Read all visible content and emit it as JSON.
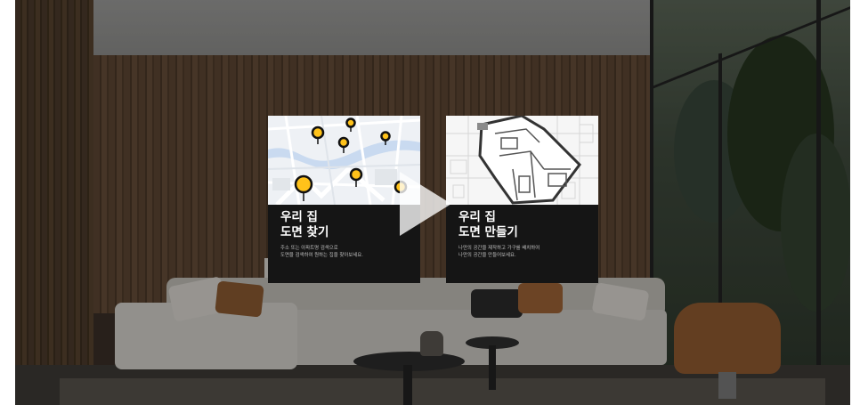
{
  "video": {
    "play_label": "play",
    "play_icon": "play-icon"
  },
  "cards": [
    {
      "title_line1": "우리 집",
      "title_line2": "도면 찾기",
      "desc_line1": "주소 또는 아파트명 검색으로",
      "desc_line2": "도면을 검색하여 원하는 집을 찾아보세요.",
      "image": "map-with-pins",
      "pin_color": "#ffc21a"
    },
    {
      "title_line1": "우리 집",
      "title_line2": "도면 만들기",
      "desc_line1": "나만의 공간을 제작하고 가구를 배치하여",
      "desc_line2": "나만의 공간을 만들어보세요.",
      "image": "floor-plan-drawing"
    }
  ],
  "colors": {
    "card_bg": "#151515",
    "accent": "#ffc21a",
    "text_primary": "#ffffff",
    "text_secondary": "#bfbfbf"
  }
}
